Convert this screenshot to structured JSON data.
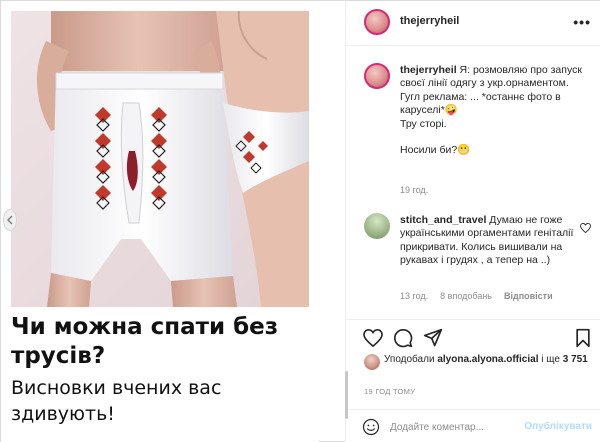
{
  "post_image": {
    "headline": "Чи можна спати без трусів?",
    "subline": "Висновки вчених вас здивують!"
  },
  "header": {
    "username": "thejerryheil",
    "more_icon": "more-horizontal-icon"
  },
  "caption": {
    "username": "thejerryheil",
    "text": "Я: розмовляю про запуск своєї лінії одягу з укр.орнаментом.",
    "line2": "Гугл реклама: ... *останнє фото в каруселі*🤪",
    "line3": "Тру сторі.",
    "line4": "Носили би?😬",
    "time": "19 год."
  },
  "comment": {
    "username": "stitch_and_travel",
    "text": "Думаю не гоже українськими оргаментами геніталії прикривати. Колись вишивали на рукавах і грудях , а тепер на ..)",
    "time": "13 год.",
    "likes": "8 вподобань",
    "reply": "Відповісти"
  },
  "actions": {
    "like_icon": "heart-icon",
    "comment_icon": "comment-icon",
    "share_icon": "paper-plane-icon",
    "save_icon": "bookmark-icon"
  },
  "likes": {
    "prefix": "Уподобали ",
    "user": "alyona.alyona.official",
    "middle": " і ще ",
    "count": "3 751"
  },
  "post_time": "19 ГОД ТОМУ",
  "comment_bar": {
    "placeholder": "Додайте коментар...",
    "post_label": "Опублікувати"
  },
  "colors": {
    "accent_disabled": "#b3dbff",
    "muted_text": "#8e8e8e",
    "text": "#262626",
    "embroidery_red": "#c0392b",
    "embroidery_black": "#222222"
  }
}
